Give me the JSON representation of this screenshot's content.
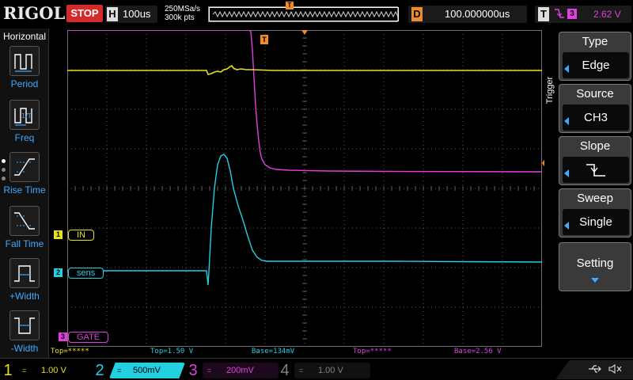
{
  "header": {
    "brand": "RIGOL",
    "run_status": "STOP",
    "horizontal_label": "H",
    "timebase": "100us",
    "sample_rate": "250MSa/s",
    "memory_depth": "300k pts",
    "delay_label": "D",
    "delay_value": "100.000000us",
    "trigger_label": "T",
    "trigger_channel": "3",
    "trigger_level": "2.62 V"
  },
  "left_menu": {
    "title": "Horizontal",
    "items": [
      {
        "label": "Period",
        "icon": "period-icon"
      },
      {
        "label": "Freq",
        "icon": "freq-icon"
      },
      {
        "label": "Rise Time",
        "icon": "rise-time-icon"
      },
      {
        "label": "Fall Time",
        "icon": "fall-time-icon"
      },
      {
        "label": "+Width",
        "icon": "pos-width-icon"
      },
      {
        "label": "-Width",
        "icon": "neg-width-icon"
      }
    ]
  },
  "channels_on_screen": [
    {
      "num": "1",
      "label": "IN",
      "color": "#e8e018"
    },
    {
      "num": "2",
      "label": "sens",
      "color": "#22d0e0"
    },
    {
      "num": "3",
      "label": "GATE",
      "color": "#e040e0"
    }
  ],
  "markers": {
    "trigger_position": "T",
    "trigger_level": "T"
  },
  "measurements": [
    {
      "text": "Top=*****",
      "color": "#e8e018"
    },
    {
      "text": "Top=1.50 V",
      "color": "#22d0e0"
    },
    {
      "text": "Base=134mV",
      "color": "#22d0e0"
    },
    {
      "text": "Top=*****",
      "color": "#e040e0"
    },
    {
      "text": "Base=2.56 V",
      "color": "#e040e0"
    }
  ],
  "right_menu": {
    "title": "Trigger",
    "buttons": [
      {
        "header": "Type",
        "value": "Edge"
      },
      {
        "header": "Source",
        "value": "CH3"
      },
      {
        "header": "Slope",
        "value": "",
        "icon": "falling-edge-icon"
      },
      {
        "header": "Sweep",
        "value": "Single"
      },
      {
        "header": "Setting",
        "value": ""
      }
    ]
  },
  "bottom_channels": [
    {
      "num": "1",
      "coupling": "=",
      "scale": "1.00 V",
      "color": "#e8e018",
      "active": false
    },
    {
      "num": "2",
      "coupling": "=",
      "scale": "500mV",
      "color": "#22d0e0",
      "active": true
    },
    {
      "num": "3",
      "coupling": "=",
      "scale": "200mV",
      "color": "#e040e0",
      "active": false
    },
    {
      "num": "4",
      "coupling": "=",
      "scale": "1.00 V",
      "color": "#808080",
      "active": false
    }
  ],
  "status_icons": [
    "usb-icon",
    "mute-icon"
  ]
}
